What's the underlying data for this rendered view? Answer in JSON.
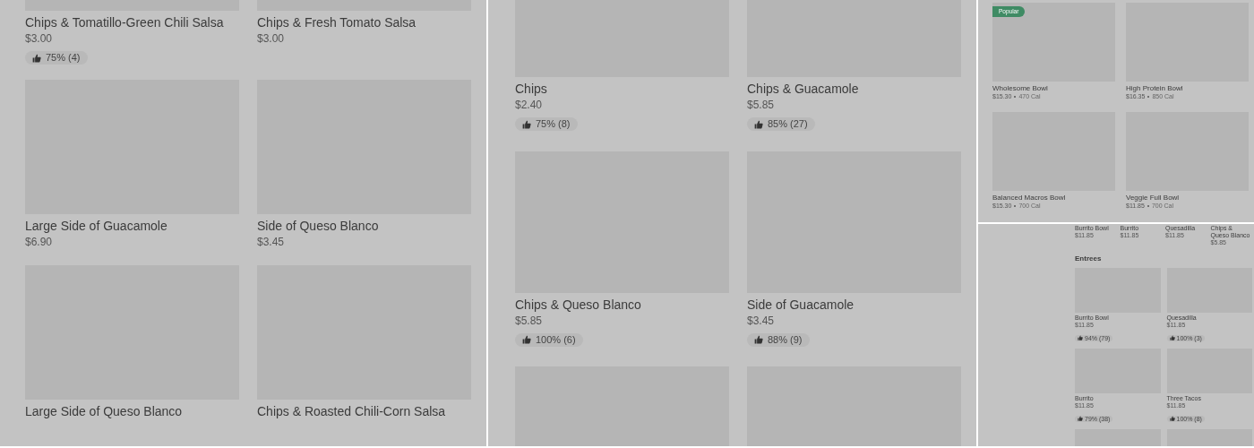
{
  "panels": [
    {
      "items": [
        {
          "kind": "card",
          "name": "Chips & Tomatillo-Green Chili Salsa",
          "price": "$3.00",
          "rating": "75% (4)"
        },
        {
          "kind": "card",
          "name": "Chips & Fresh Tomato Salsa",
          "price": "$3.00"
        },
        {
          "kind": "card",
          "name": "Large Side of Guacamole",
          "price": "$6.90"
        },
        {
          "kind": "card",
          "name": "Side of Queso Blanco",
          "price": "$3.45"
        },
        {
          "kind": "card",
          "name": "Large Side of Queso Blanco"
        },
        {
          "kind": "card",
          "name": "Chips & Roasted Chili-Corn Salsa"
        }
      ]
    },
    {
      "items": [
        {
          "kind": "card",
          "name": "Chips",
          "price": "$2.40",
          "rating": "75% (8)"
        },
        {
          "kind": "card",
          "name": "Chips & Guacamole",
          "price": "$5.85",
          "rating": "85% (27)"
        },
        {
          "kind": "card",
          "name": "Chips & Queso Blanco",
          "price": "$5.85",
          "rating": "100% (6)"
        },
        {
          "kind": "card",
          "name": "Side of Guacamole",
          "price": "$3.45",
          "rating": "88% (9)"
        },
        {
          "kind": "tile"
        },
        {
          "kind": "tile"
        }
      ]
    },
    {
      "items": [
        {
          "kind": "card",
          "badge": "Popular",
          "name": "Wholesome Bowl",
          "price": "$15.30",
          "calories": "470 Cal"
        },
        {
          "kind": "card",
          "name": "High Protein Bowl",
          "price": "$16.35",
          "calories": "850 Cal"
        },
        {
          "kind": "card",
          "name": "Balanced Macros Bowl",
          "price": "$15.30",
          "calories": "700 Cal"
        },
        {
          "kind": "card",
          "name": "Veggie Full Bowl",
          "price": "$11.85",
          "calories": "700 Cal"
        }
      ]
    },
    {
      "top_row": [
        {
          "name": "Burrito Bowl",
          "price": "$11.85"
        },
        {
          "name": "Burrito",
          "price": "$11.85"
        },
        {
          "name": "Quesadilla",
          "price": "$11.85"
        },
        {
          "name": "Chips & Queso Blanco",
          "price": "$5.85"
        }
      ],
      "section": "Entrees",
      "items": [
        {
          "kind": "card",
          "name": "Burrito Bowl",
          "price": "$11.85",
          "rating": "94% (79)"
        },
        {
          "kind": "card",
          "name": "Quesadilla",
          "price": "$11.85",
          "rating": "100% (3)"
        },
        {
          "kind": "card",
          "name": "Burrito",
          "price": "$11.85",
          "rating": "79% (38)"
        },
        {
          "kind": "card",
          "name": "Three Tacos",
          "price": "$11.85",
          "rating": "100% (8)"
        },
        {
          "kind": "tile"
        },
        {
          "kind": "tile"
        }
      ]
    }
  ]
}
